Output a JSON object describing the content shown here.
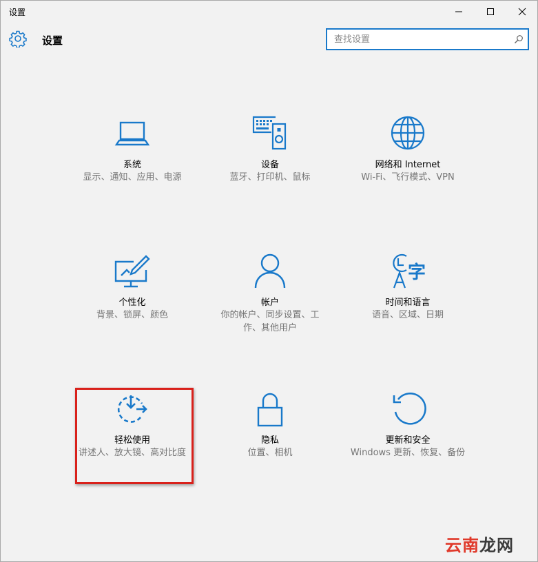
{
  "window": {
    "title": "设置"
  },
  "header": {
    "heading": "设置",
    "search_placeholder": "查找设置"
  },
  "tiles": [
    {
      "name": "系统",
      "desc": "显示、通知、应用、电源",
      "icon": "laptop-icon"
    },
    {
      "name": "设备",
      "desc": "蓝牙、打印机、鼠标",
      "icon": "keyboard-speaker-icon"
    },
    {
      "name": "网络和 Internet",
      "desc": "Wi-Fi、飞行模式、VPN",
      "icon": "globe-icon"
    },
    {
      "name": "个性化",
      "desc": "背景、锁屏、颜色",
      "icon": "monitor-brush-icon"
    },
    {
      "name": "帐户",
      "desc": "你的帐户、同步设置、工作、其他用户",
      "icon": "person-icon"
    },
    {
      "name": "时间和语言",
      "desc": "语音、区域、日期",
      "icon": "clock-language-icon"
    },
    {
      "name": "轻松使用",
      "desc": "讲述人、放大镜、高对比度",
      "icon": "ease-of-access-icon"
    },
    {
      "name": "隐私",
      "desc": "位置、相机",
      "icon": "lock-icon"
    },
    {
      "name": "更新和安全",
      "desc": "Windows 更新、恢复、备份",
      "icon": "refresh-icon"
    }
  ],
  "watermark": {
    "part1": "云南",
    "part2": "龙网"
  },
  "colors": {
    "accent": "#1979ca",
    "highlight": "#d9211b",
    "background": "#f2f2f2"
  }
}
